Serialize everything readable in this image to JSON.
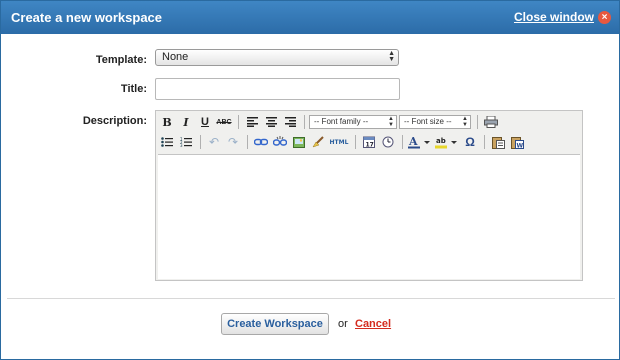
{
  "dialog": {
    "title": "Create a new workspace",
    "close_label": "Close window",
    "close_icon": "×"
  },
  "form": {
    "template_label": "Template:",
    "template_value": "None",
    "title_label": "Title:",
    "title_value": "",
    "description_label": "Description:"
  },
  "editor": {
    "font_family_placeholder": "-- Font family --",
    "font_size_placeholder": "-- Font size --",
    "toolbar_row1": [
      "bold-icon",
      "italic-icon",
      "underline-icon",
      "strikethrough-icon",
      "align-left-icon",
      "align-center-icon",
      "align-right-icon",
      "print-icon"
    ],
    "toolbar_row2": [
      "bullet-list-icon",
      "numbered-list-icon",
      "undo-icon",
      "redo-icon",
      "link-icon",
      "unlink-icon",
      "image-icon",
      "cleanup-icon",
      "html-icon",
      "insert-date-icon",
      "insert-time-icon",
      "text-color-icon",
      "highlight-color-icon",
      "special-char-icon",
      "paste-text-icon",
      "paste-word-icon"
    ],
    "html_label": "HTML",
    "date_label": "17",
    "omega": "Ω",
    "text_color_letter": "A",
    "highlight_letters": "ab"
  },
  "footer": {
    "create_label": "Create Workspace",
    "or_text": "or",
    "cancel_label": "Cancel"
  },
  "colors": {
    "titlebar": "#2f72ae",
    "link_blue": "#2a5f9e",
    "cancel_red": "#d42b1e",
    "close_icon_bg": "#e8583f"
  }
}
